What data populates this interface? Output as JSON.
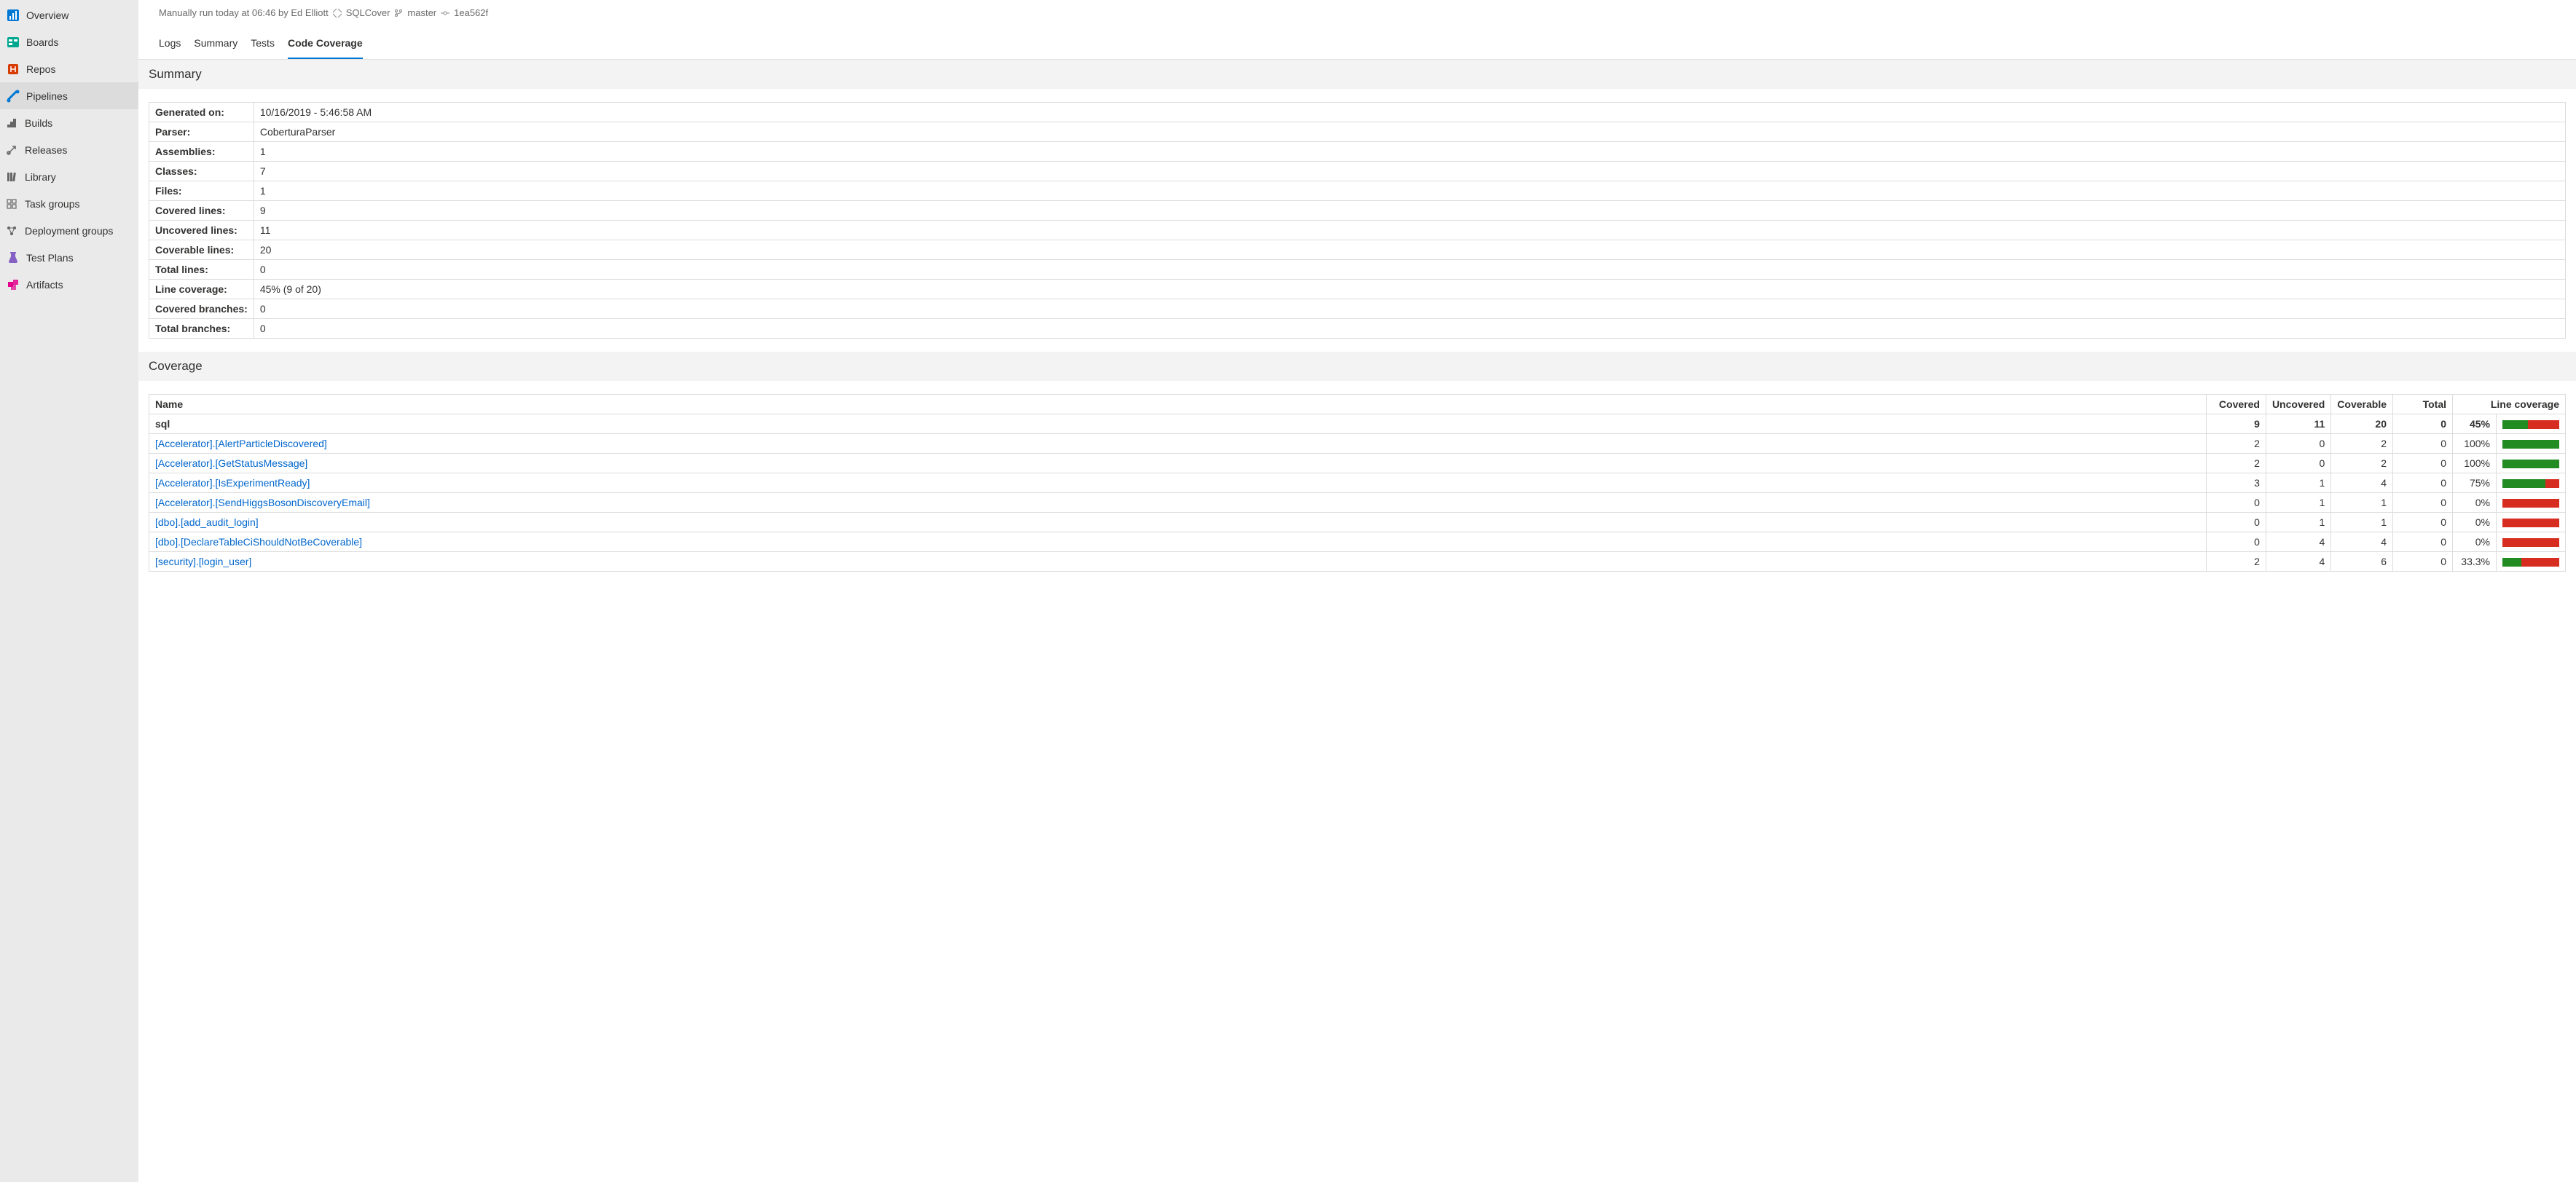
{
  "sidebar": {
    "items": [
      {
        "label": "Overview"
      },
      {
        "label": "Boards"
      },
      {
        "label": "Repos"
      },
      {
        "label": "Pipelines"
      },
      {
        "label": "Builds"
      },
      {
        "label": "Releases"
      },
      {
        "label": "Library"
      },
      {
        "label": "Task groups"
      },
      {
        "label": "Deployment groups"
      },
      {
        "label": "Test Plans"
      },
      {
        "label": "Artifacts"
      }
    ]
  },
  "run_info": {
    "text": "Manually run today at 06:46 by Ed Elliott",
    "repo": "SQLCover",
    "branch": "master",
    "commit": "1ea562f"
  },
  "tabs": [
    {
      "label": "Logs"
    },
    {
      "label": "Summary"
    },
    {
      "label": "Tests"
    },
    {
      "label": "Code Coverage"
    }
  ],
  "summary_heading": "Summary",
  "summary_rows": [
    {
      "k": "Generated on:",
      "v": "10/16/2019 - 5:46:58 AM"
    },
    {
      "k": "Parser:",
      "v": "CoberturaParser"
    },
    {
      "k": "Assemblies:",
      "v": "1"
    },
    {
      "k": "Classes:",
      "v": "7"
    },
    {
      "k": "Files:",
      "v": "1"
    },
    {
      "k": "Covered lines:",
      "v": "9"
    },
    {
      "k": "Uncovered lines:",
      "v": "11"
    },
    {
      "k": "Coverable lines:",
      "v": "20"
    },
    {
      "k": "Total lines:",
      "v": "0"
    },
    {
      "k": "Line coverage:",
      "v": "45% (9 of 20)"
    },
    {
      "k": "Covered branches:",
      "v": "0"
    },
    {
      "k": "Total branches:",
      "v": "0"
    }
  ],
  "coverage_heading": "Coverage",
  "coverage_headers": {
    "name": "Name",
    "covered": "Covered",
    "uncovered": "Uncovered",
    "coverable": "Coverable",
    "total": "Total",
    "line_coverage": "Line coverage"
  },
  "coverage_summary": {
    "name": "sql",
    "covered": "9",
    "uncovered": "11",
    "coverable": "20",
    "total": "0",
    "pct": "45%",
    "pct_num": 45
  },
  "coverage_rows": [
    {
      "name": "[Accelerator].[AlertParticleDiscovered]",
      "covered": "2",
      "uncovered": "0",
      "coverable": "2",
      "total": "0",
      "pct": "100%",
      "pct_num": 100
    },
    {
      "name": "[Accelerator].[GetStatusMessage]",
      "covered": "2",
      "uncovered": "0",
      "coverable": "2",
      "total": "0",
      "pct": "100%",
      "pct_num": 100
    },
    {
      "name": "[Accelerator].[IsExperimentReady]",
      "covered": "3",
      "uncovered": "1",
      "coverable": "4",
      "total": "0",
      "pct": "75%",
      "pct_num": 75
    },
    {
      "name": "[Accelerator].[SendHiggsBosonDiscoveryEmail]",
      "covered": "0",
      "uncovered": "1",
      "coverable": "1",
      "total": "0",
      "pct": "0%",
      "pct_num": 0
    },
    {
      "name": "[dbo].[add_audit_login]",
      "covered": "0",
      "uncovered": "1",
      "coverable": "1",
      "total": "0",
      "pct": "0%",
      "pct_num": 0
    },
    {
      "name": "[dbo].[DeclareTableCiShouldNotBeCoverable]",
      "covered": "0",
      "uncovered": "4",
      "coverable": "4",
      "total": "0",
      "pct": "0%",
      "pct_num": 0
    },
    {
      "name": "[security].[login_user]",
      "covered": "2",
      "uncovered": "4",
      "coverable": "6",
      "total": "0",
      "pct": "33.3%",
      "pct_num": 33.3
    }
  ]
}
